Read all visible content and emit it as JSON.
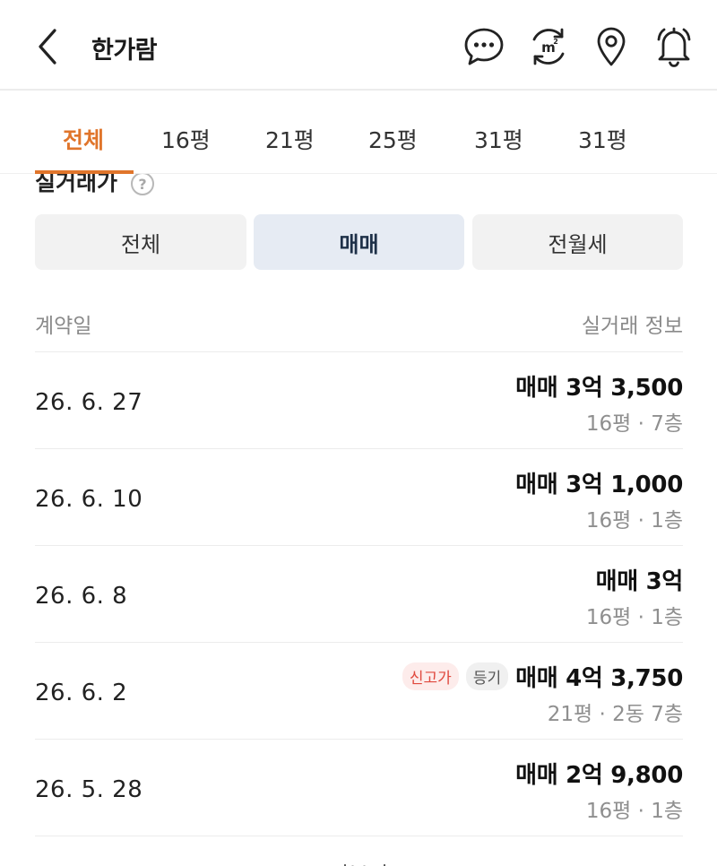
{
  "header": {
    "title": "한가람",
    "icons": [
      "back-icon",
      "chat-icon",
      "area-unit-icon",
      "location-pin-icon",
      "bell-icon"
    ]
  },
  "tabs": [
    {
      "label": "전체",
      "active": true
    },
    {
      "label": "16평",
      "active": false
    },
    {
      "label": "21평",
      "active": false
    },
    {
      "label": "25평",
      "active": false
    },
    {
      "label": "31평",
      "active": false
    },
    {
      "label": "31평",
      "active": false
    }
  ],
  "section": {
    "title": "실거래가",
    "help": "?"
  },
  "filter": {
    "options": [
      {
        "label": "전체",
        "active": false
      },
      {
        "label": "매매",
        "active": true
      },
      {
        "label": "전월세",
        "active": false
      }
    ]
  },
  "list": {
    "head_left": "계약일",
    "head_right": "실거래 정보",
    "rows": [
      {
        "date": "26. 6. 27",
        "price": "매매 3억 3,500",
        "meta": "16평 · 7층",
        "badges": []
      },
      {
        "date": "26. 6. 10",
        "price": "매매 3억 1,000",
        "meta": "16평 · 1층",
        "badges": []
      },
      {
        "date": "26. 6. 8",
        "price": "매매 3억",
        "meta": "16평 · 1층",
        "badges": []
      },
      {
        "date": "26. 6. 2",
        "price": "매매 4억 3,750",
        "meta": "21평 · 2동 7층",
        "badges": [
          "신고가",
          "등기"
        ]
      },
      {
        "date": "26. 5. 28",
        "price": "매매 2억 9,800",
        "meta": "16평 · 1층",
        "badges": []
      }
    ]
  },
  "more_label": "더보기",
  "colors": {
    "accent": "#e0752b",
    "active_segment_bg": "#e6ebf3",
    "badge_red": "#e0493e"
  }
}
